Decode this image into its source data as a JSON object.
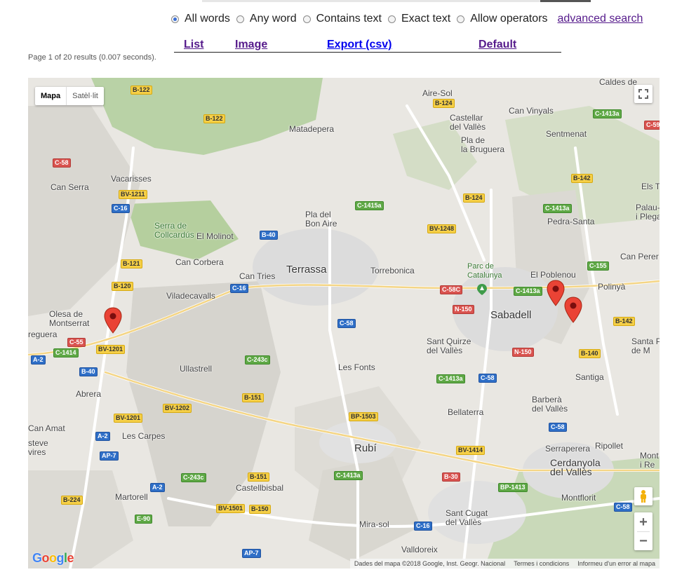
{
  "search_options": {
    "items": [
      {
        "label": "All words",
        "checked": true
      },
      {
        "label": "Any word",
        "checked": false
      },
      {
        "label": "Contains text",
        "checked": false
      },
      {
        "label": "Exact text",
        "checked": false
      },
      {
        "label": "Allow operators",
        "checked": false
      }
    ],
    "advanced_link": "advanced search"
  },
  "view_tabs": {
    "list": "List",
    "image": "Image",
    "export": "Export (csv)",
    "default": "Default"
  },
  "results_info": "Page 1  of  20 results (0.007 seconds).",
  "map": {
    "type_control": {
      "map": "Mapa",
      "satellite": "Satèl·lit"
    },
    "zoom_in": "+",
    "zoom_out": "−",
    "google_logo": "Google",
    "attribution": {
      "data": "Dades del mapa ©2018 Google, Inst. Geogr. Nacional",
      "terms": "Termes i condicions",
      "report": "Informeu d'un error al mapa"
    },
    "places": {
      "terrassa": "Terrassa",
      "sabadell": "Sabadell",
      "rubi": "Rubí",
      "matadepera": "Matadepera",
      "castellar": "Castellar\ndel Vallès",
      "pla_bruguera": "Pla de\nla Bruguera",
      "can_vinyals": "Can Vinyals",
      "sentmenat": "Sentmenat",
      "aire_sol": "Aire-Sol",
      "vacarisses": "Vacarisses",
      "can_serra": "Can Serra",
      "serra_collcardus": "Serra de\nCollcardús",
      "el_molinot": "El Molinot",
      "pla_bon_aire": "Pla del\nBon Aire",
      "can_corbera": "Can Corbera",
      "can_tries": "Can Tries",
      "viladecavalls": "Viladecavalls",
      "torrebonica": "Torrebonica",
      "parc_catalunya": "Parc de\nCatalunya",
      "el_poblenou": "El Poblenou",
      "polinya": "Polinyà",
      "pedra_santa": "Pedra-Santa",
      "palau": "Palau-\ni Plegam",
      "can_perer": "Can Perer",
      "els_t": "Els T",
      "olesa": "Olesa de\nMontserrat",
      "esparreguera": "reguera",
      "ullastrell": "Ullastrell",
      "sant_quirze": "Sant Quirze\ndel Vallès",
      "les_fonts": "Les Fonts",
      "santa_perpetua": "Santa P\nde M",
      "santiga": "Santiga",
      "abrera": "Abrera",
      "barbera": "Barberà\ndel Vallès",
      "bellaterra": "Bellaterra",
      "serraperera": "Serraperera",
      "ripollet": "Ripollet",
      "cerdanyola": "Cerdanyola\ndel Vallès",
      "montflorit": "Montflorit",
      "mont": "Mont\ni Re",
      "can_amat": "Can Amat",
      "esteve": "steve\nvires",
      "les_carpes": "Les Carpes",
      "martorell": "Martorell",
      "castellbisbal": "Castellbisbal",
      "sant_cugat": "Sant Cugat\ndel Vallès",
      "mira_sol": "Mira-sol",
      "valldoreix": "Valldoreix",
      "caldes": "Caldes de"
    },
    "roads": {
      "b122a": "B-122",
      "b122b": "B-122",
      "b124a": "B-124",
      "c1413a": "C-1413a",
      "c58a": "C-58",
      "c59": "C-59",
      "bv1211": "BV-1211",
      "c16a": "C-16",
      "c1415a": "C-1415a",
      "b124b": "B-124",
      "b142a": "B-142",
      "c1413b": "C-1413a",
      "b40a": "B-40",
      "bv1248": "BV-1248",
      "b121": "B-121",
      "b120": "B-120",
      "c16b": "C-16",
      "c58c": "C-58C",
      "c1413c": "C-1413a",
      "c155": "C-155",
      "n150a": "N-150",
      "c58b": "C-58",
      "b142b": "B-142",
      "c55": "C-55",
      "bv1201a": "BV-1201",
      "c1414": "C-1414",
      "a2a": "A-2",
      "b40b": "B-40",
      "c243a": "C-243c",
      "n150b": "N-150",
      "b140": "B-140",
      "c1413d": "C-1413a",
      "c58d": "C-58",
      "b151a": "B-151",
      "bv1202": "BV-1202",
      "bp1503": "BP-1503",
      "c58e": "C-58",
      "bv1201b": "BV-1201",
      "a2b": "A-2",
      "ap7a": "AP-7",
      "bv1414": "BV-1414",
      "c1413e": "C-1413a",
      "b30": "B-30",
      "c243b": "C-243c",
      "b151b": "B-151",
      "a2c": "A-2",
      "bp1413": "BP-1413",
      "b224": "B-224",
      "bv1501": "BV-1501",
      "b150": "B-150",
      "c58f": "C-58",
      "e90": "E-90",
      "c16c": "C-16",
      "ap7b": "AP-7"
    }
  }
}
